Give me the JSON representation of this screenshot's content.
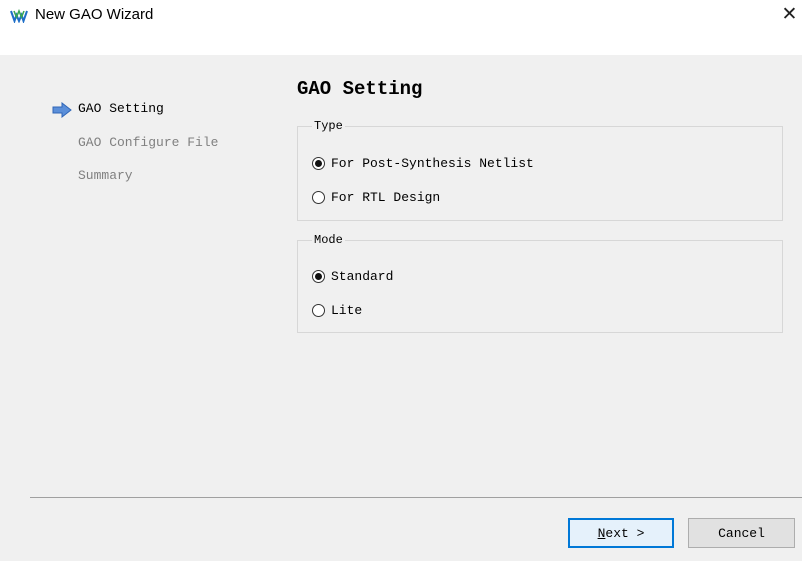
{
  "window": {
    "title": "New GAO Wizard",
    "close_glyph": "✕",
    "app_icon": "gowin-logo-icon"
  },
  "steps": [
    {
      "label": "GAO Setting",
      "active": true
    },
    {
      "label": "GAO Configure File",
      "active": false
    },
    {
      "label": "Summary",
      "active": false
    }
  ],
  "current_step_icon": "arrow-right-icon",
  "page": {
    "title": "GAO Setting"
  },
  "type_group": {
    "legend": "Type",
    "options": [
      {
        "label": "For Post-Synthesis Netlist",
        "selected": true
      },
      {
        "label": "For RTL Design",
        "selected": false
      }
    ]
  },
  "mode_group": {
    "legend": "Mode",
    "options": [
      {
        "label": "Standard",
        "selected": true
      },
      {
        "label": "Lite",
        "selected": false
      }
    ]
  },
  "buttons": {
    "next_mnemonic": "N",
    "next_rest": "ext >",
    "cancel": "Cancel"
  },
  "colors": {
    "accent": "#0078d7",
    "arrow": "#5b8fd9",
    "inactive_text": "#808080"
  }
}
